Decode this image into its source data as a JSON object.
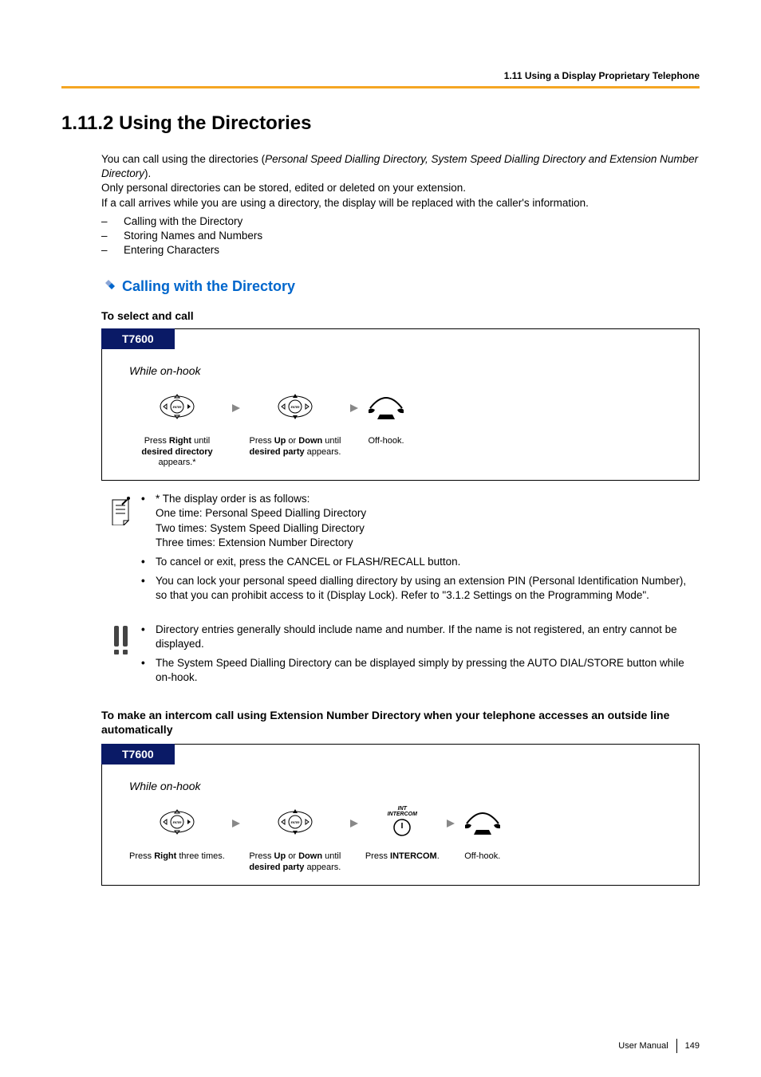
{
  "header": {
    "breadcrumb": "1.11 Using a Display Proprietary Telephone"
  },
  "title": "1.11.2  Using the Directories",
  "intro": {
    "line1_a": "You can call using the directories (",
    "line1_italic": "Personal Speed Dialling Directory, System Speed Dialling Directory and Extension Number Directory",
    "line1_b": ").",
    "line2": "Only personal directories can be stored, edited or deleted on your extension.",
    "line3": "If a call arrives while you are using a directory, the display will be replaced with the caller's information."
  },
  "toc": [
    "Calling with the Directory",
    "Storing Names and Numbers",
    "Entering Characters"
  ],
  "section1": {
    "heading": "Calling with the Directory"
  },
  "proc1": {
    "heading": "To select and call",
    "badge": "T7600",
    "state": "While on-hook",
    "step1_a": "Press ",
    "step1_b": "Right",
    "step1_c": " until ",
    "step1_d": "desired directory",
    "step1_e": " appears.*",
    "step2_a": "Press ",
    "step2_b": "Up",
    "step2_c": " or ",
    "step2_d": "Down",
    "step2_e": " until ",
    "step2_f": "desired party",
    "step2_g": " appears.",
    "step3": "Off-hook."
  },
  "note1": {
    "l1": "* The display order is as follows:",
    "l2": "One time: Personal Speed Dialling Directory",
    "l3": "Two times: System Speed Dialling Directory",
    "l4": "Three times: Extension Number Directory",
    "b2": "To cancel or exit, press the CANCEL or FLASH/RECALL button.",
    "b3": "You can lock your personal speed dialling directory by using an extension PIN (Personal Identification Number), so that you can prohibit access to it (Display Lock). Refer to \"3.1.2 Settings on the Programming Mode\"."
  },
  "note2": {
    "b1": "Directory entries generally should include name and number. If the name is not registered, an entry cannot be displayed.",
    "b2": "The System Speed Dialling Directory can be displayed simply by pressing the AUTO DIAL/STORE button while on-hook."
  },
  "proc2": {
    "heading": "To make an intercom call using Extension Number Directory when your telephone accesses an outside line automatically",
    "badge": "T7600",
    "state": "While on-hook",
    "step1_a": "Press ",
    "step1_b": "Right",
    "step1_c": " three times.",
    "step2_a": "Press ",
    "step2_b": "Up",
    "step2_c": " or ",
    "step2_d": "Down",
    "step2_e": " until ",
    "step2_f": "desired party",
    "step2_g": " appears.",
    "step3_a": "Press ",
    "step3_b": "INTERCOM",
    "step3_c": ".",
    "step4": "Off-hook.",
    "intercom_label1": "INT",
    "intercom_label2": "INTERCOM"
  },
  "footer": {
    "label": "User Manual",
    "page": "149"
  },
  "icons": {
    "enter": "ENTER"
  }
}
